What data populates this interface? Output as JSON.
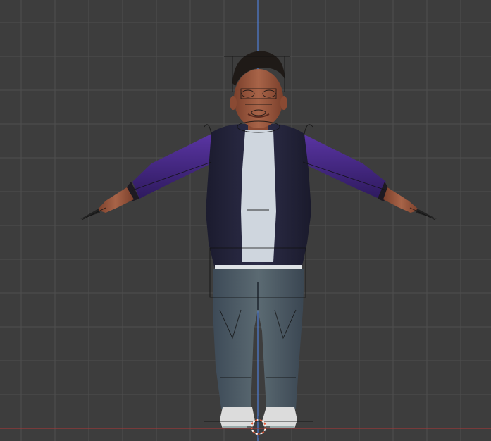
{
  "viewport": {
    "background": "#3d3d3d",
    "grid_color": "#4e4e4e",
    "z_axis_color": "#4f7fd6",
    "x_axis_color": "#9b3a3a"
  },
  "model": {
    "jacket_body_color": "#23233a",
    "sleeve_color": "#4a2a8a",
    "shirt_color": "#cfd6de",
    "jeans_color": "#4b5a68",
    "skin_color": "#9c5a3e",
    "hair_color": "#1f1a17",
    "shoe_color": "#dcdcdc"
  },
  "icons": {
    "origin": "3d-cursor-icon",
    "armature": "armature-overlay-icon"
  }
}
